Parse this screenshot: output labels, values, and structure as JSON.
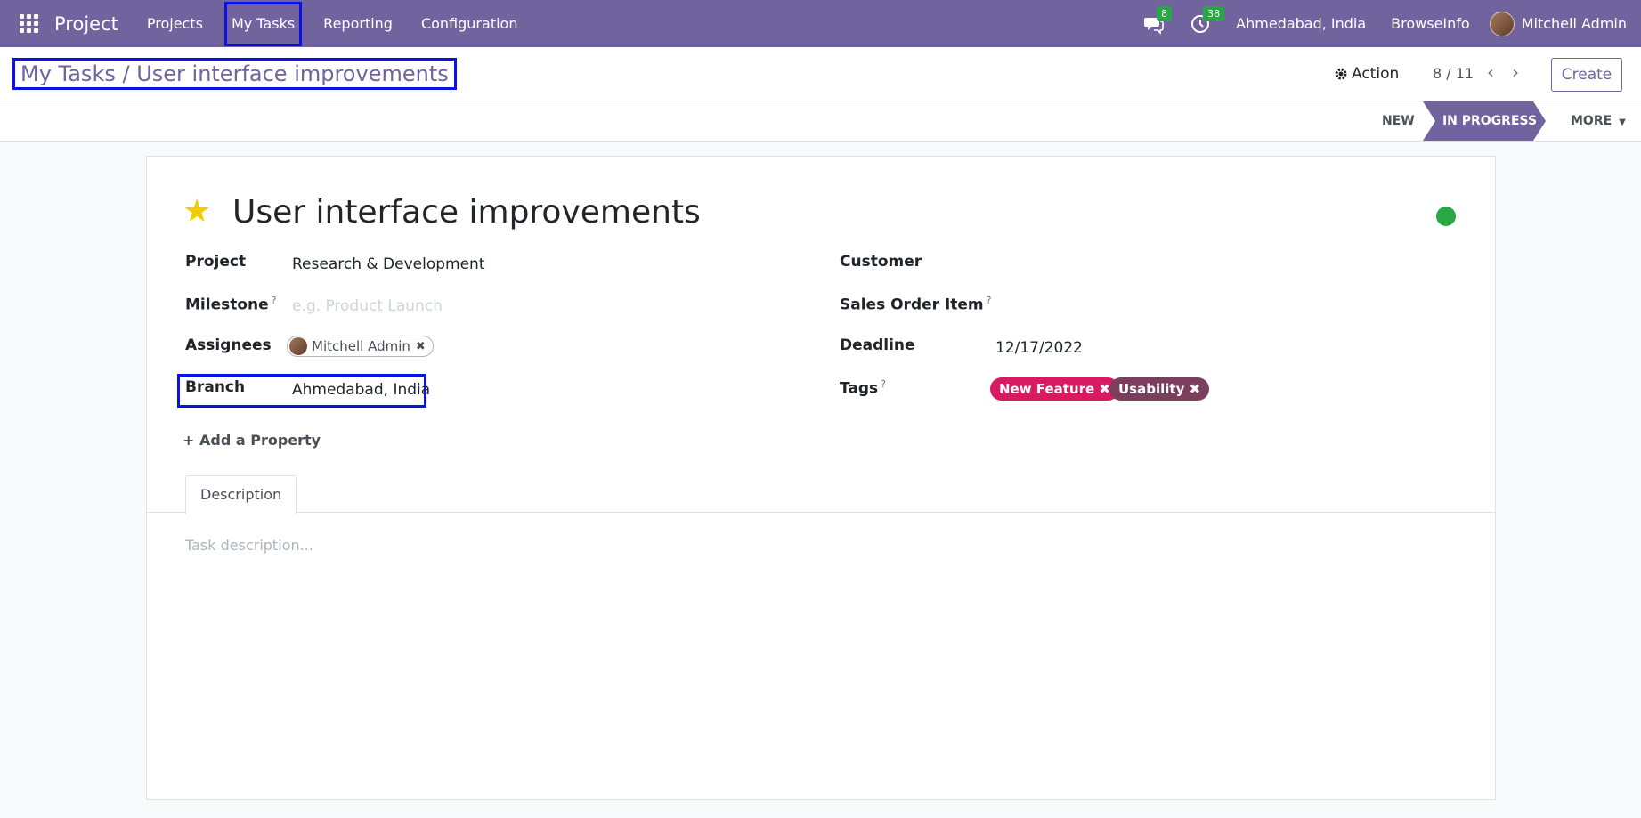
{
  "navbar": {
    "app_name": "Project",
    "menu": [
      "Projects",
      "My Tasks",
      "Reporting",
      "Configuration"
    ],
    "messages_count": "8",
    "activities_count": "38",
    "company": "Ahmedabad, India",
    "company2": "BrowseInfo",
    "user": "Mitchell Admin"
  },
  "control": {
    "breadcrumb_parent": "My Tasks",
    "breadcrumb_sep": " / ",
    "breadcrumb_current": "User interface improvements",
    "action_label": "Action",
    "pager": "8 / 11",
    "create_label": "Create"
  },
  "statusbar": {
    "stages": [
      "NEW",
      "IN PROGRESS"
    ],
    "more_label": "MORE"
  },
  "task": {
    "title": "User interface improvements",
    "fields_left": {
      "project_label": "Project",
      "project_value": "Research & Development",
      "milestone_label": "Milestone",
      "milestone_placeholder": "e.g. Product Launch",
      "assignees_label": "Assignees",
      "assignee": "Mitchell Admin",
      "branch_label": "Branch",
      "branch_value": "Ahmedabad, India"
    },
    "fields_right": {
      "customer_label": "Customer",
      "sale_line_label": "Sales Order Item",
      "deadline_label": "Deadline",
      "deadline_value": "12/17/2022",
      "tags_label": "Tags",
      "tags": [
        "New Feature",
        "Usability"
      ]
    },
    "help_mark": "?",
    "add_property": "Add a Property",
    "tab_description": "Description",
    "description_placeholder": "Task description..."
  },
  "colors": {
    "brand": "#71639e",
    "tag_new_feature": "#d81b60",
    "tag_usability": "#7a3f5f",
    "status_done": "#28a745",
    "highlight_box": "#0a12e8"
  }
}
